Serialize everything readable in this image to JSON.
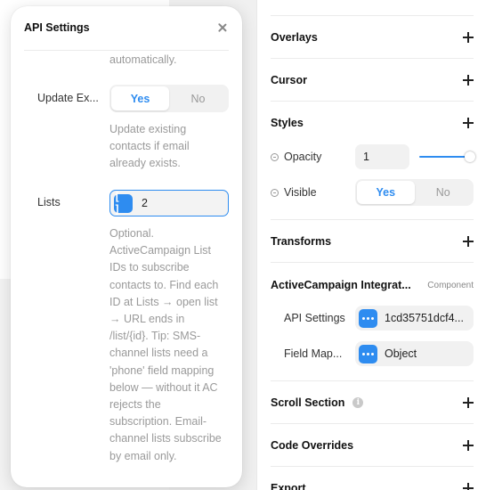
{
  "popover": {
    "title": "API Settings",
    "top_desc": "automatically.",
    "update_existing": {
      "label": "Update Ex...",
      "options": [
        "Yes",
        "No"
      ],
      "selected": "Yes",
      "desc": "Update existing contacts if email already exists."
    },
    "lists": {
      "label": "Lists",
      "value": "2",
      "desc": "Optional. ActiveCampaign List IDs to subscribe contacts to. Find each ID at Lists → open list → URL ends in /list/{id}. Tip: SMS-channel lists need a 'phone' field mapping below — without it AC rejects the subscription. Email-channel lists subscribe by email only."
    }
  },
  "panel": {
    "overlays": "Overlays",
    "cursor": "Cursor",
    "styles": {
      "title": "Styles",
      "opacity_label": "Opacity",
      "opacity_value": "1",
      "opacity_level": 1.0,
      "visible_label": "Visible",
      "visible_options": [
        "Yes",
        "No"
      ],
      "visible_selected": "Yes"
    },
    "transforms": "Transforms",
    "component": {
      "title": "ActiveCampaign Integrat...",
      "badge": "Component",
      "api_settings_label": "API Settings",
      "api_settings_value": "1cd35751dcf4...",
      "field_map_label": "Field Map...",
      "field_map_value": "Object"
    },
    "scroll_section": "Scroll Section",
    "code_overrides": "Code Overrides",
    "export": "Export"
  },
  "colors": {
    "accent": "#2e8cf0",
    "muted_text": "#9a9a9a"
  }
}
